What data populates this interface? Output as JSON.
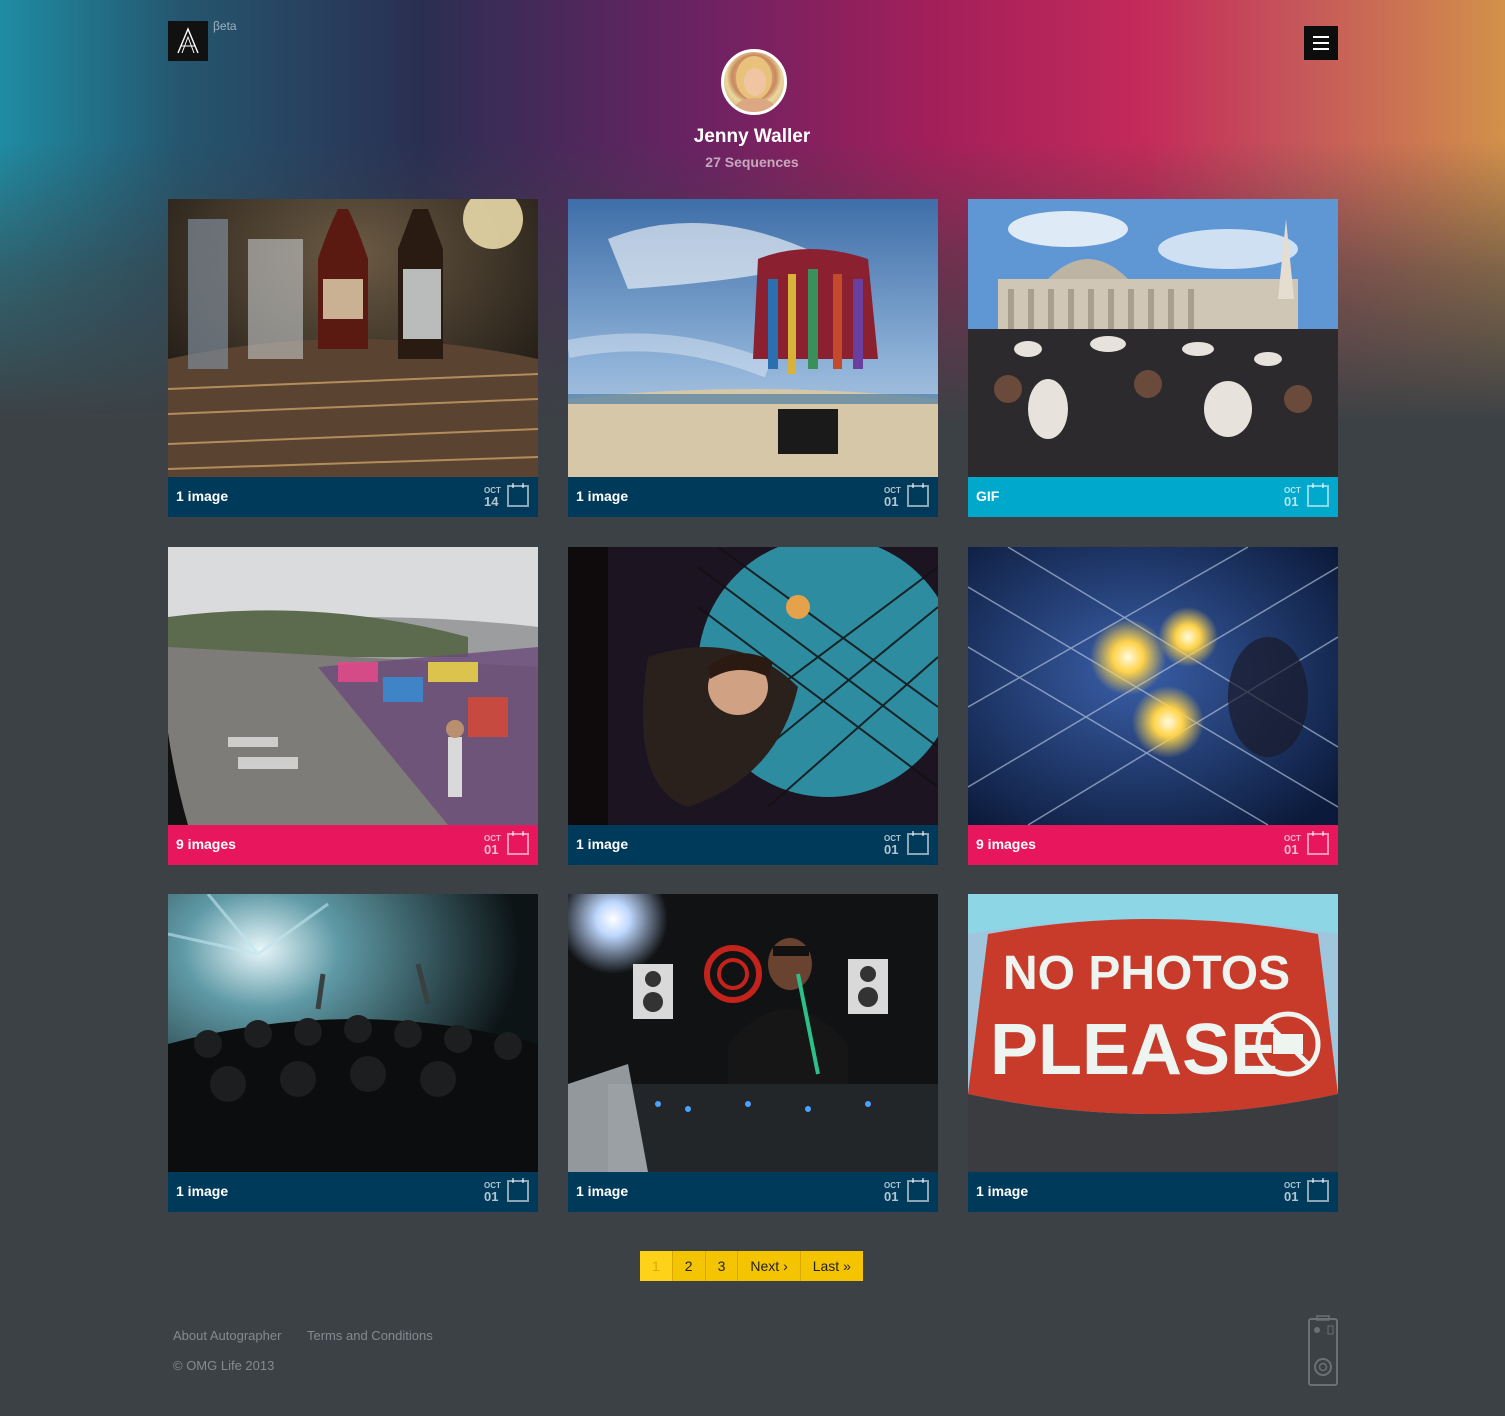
{
  "header": {
    "logo_alt": "A",
    "beta_label": "βeta",
    "menu_icon": "hamburger-menu-icon"
  },
  "profile": {
    "name": "Jenny Waller",
    "sequence_count": "27 Sequences"
  },
  "colors": {
    "bar_navy": "#003a5b",
    "bar_cyan": "#00a9cc",
    "bar_pink": "#e8175d",
    "pagination_yellow": "#f4c400"
  },
  "cards": [
    {
      "label": "1 image",
      "month": "OCT",
      "day": "14",
      "style": "navy",
      "photo": "bar bottles fisheye"
    },
    {
      "label": "1 image",
      "month": "OCT",
      "day": "01",
      "style": "navy",
      "photo": "beach vendor fisheye"
    },
    {
      "label": "GIF",
      "month": "OCT",
      "day": "01",
      "style": "cyan",
      "photo": "trafalgar square pillow fight"
    },
    {
      "label": "9 images",
      "month": "OCT",
      "day": "01",
      "style": "pink",
      "photo": "graffiti rooftop"
    },
    {
      "label": "1 image",
      "month": "OCT",
      "day": "01",
      "style": "navy",
      "photo": "man under net"
    },
    {
      "label": "9 images",
      "month": "OCT",
      "day": "01",
      "style": "pink",
      "photo": "lights under net"
    },
    {
      "label": "1 image",
      "month": "OCT",
      "day": "01",
      "style": "navy",
      "photo": "concert crowd"
    },
    {
      "label": "1 image",
      "month": "OCT",
      "day": "01",
      "style": "navy",
      "photo": "dj with microphone"
    },
    {
      "label": "1 image",
      "month": "OCT",
      "day": "01",
      "style": "navy",
      "photo": "no photos please wall"
    }
  ],
  "pagination": {
    "pages": [
      "1",
      "2",
      "3"
    ],
    "current": "1",
    "next": "Next ›",
    "last": "Last »"
  },
  "footer": {
    "links": [
      "About Autographer",
      "Terms and Conditions"
    ],
    "copyright": "© OMG Life 2013",
    "device_icon": "autographer-camera-icon"
  }
}
